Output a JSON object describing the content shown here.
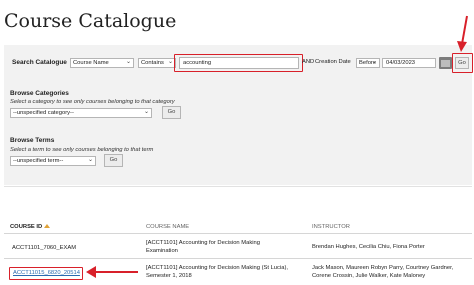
{
  "page": {
    "title": "Course Catalogue"
  },
  "search": {
    "label": "Search Catalogue",
    "field_select": "Course Name",
    "operator_select": "Contains",
    "query_value": "accounting",
    "and_label": "AND",
    "date_field_select": "Creation Date",
    "date_operator_select": "Before",
    "date_value": "04/03/2023",
    "go_label": "Go"
  },
  "categories": {
    "heading": "Browse Categories",
    "hint": "Select a category to see only courses belonging to that category",
    "select_value": "--unspecified category--",
    "go_label": "Go"
  },
  "terms": {
    "heading": "Browse Terms",
    "hint": "Select a term to see only courses belonging to that term",
    "select_value": "--unspecified term--",
    "go_label": "Go"
  },
  "table": {
    "headers": [
      "COURSE ID",
      "COURSE NAME",
      "INSTRUCTOR"
    ],
    "rows": [
      {
        "course_id": "ACCT1101_7060_EXAM",
        "name_line1": "[ACCT1101] Accounting for Decision Making",
        "name_line2": "Examination",
        "instructor_line1": "Brendan Hughes, Cecilia Chiu, Fiona Porter",
        "instructor_line2": ""
      },
      {
        "course_id": "ACCT11015_6820_20514",
        "name_line1": "[ACCT1101] Accounting for Decision Making (St Lucia),",
        "name_line2": "Semester 1, 2018",
        "instructor_line1": "Jack Mason, Maureen Robyn Parry, Courtney Gardner,",
        "instructor_line2": "Corene Crossin, Julie Walker, Kate Maloney"
      }
    ]
  },
  "colors": {
    "annotation": "#d8202a",
    "link": "#2a6ab0",
    "panel": "#f2f2f2"
  }
}
